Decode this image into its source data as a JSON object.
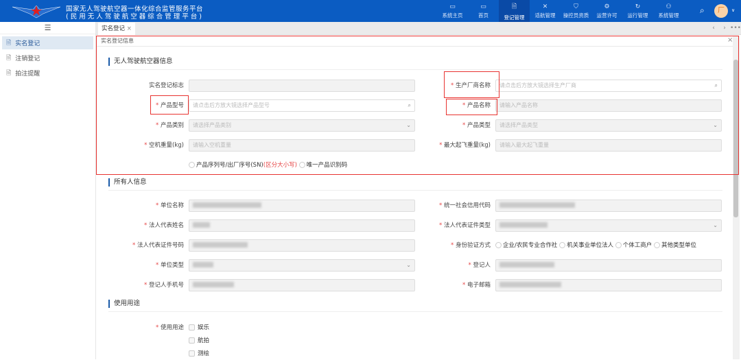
{
  "header": {
    "title_line1": "国家无人驾驶航空器一体化综合监管服务平台",
    "title_line2": "(民用无人驾驶航空器综合管理平台)",
    "brand_color": "#0b5cc2",
    "nav": [
      {
        "label": "系统主页",
        "icon": "window-icon"
      },
      {
        "label": "首页",
        "icon": "monitor-icon"
      },
      {
        "label": "登记管理",
        "icon": "document-icon",
        "active": true
      },
      {
        "label": "适航管理",
        "icon": "drone-icon"
      },
      {
        "label": "操控员资质",
        "icon": "shield-icon"
      },
      {
        "label": "运营许可",
        "icon": "gear-icon"
      },
      {
        "label": "运行管理",
        "icon": "refresh-icon"
      },
      {
        "label": "系统管理",
        "icon": "network-icon"
      }
    ],
    "avatar_letter": "厂"
  },
  "sidebar": {
    "items": [
      {
        "label": "实名登记",
        "active": true
      },
      {
        "label": "注销登记"
      },
      {
        "label": "拍注提醒"
      }
    ]
  },
  "tabs": [
    {
      "label": "实名登记",
      "close": "×"
    }
  ],
  "panel": {
    "title": "实名登记信息",
    "close": "×"
  },
  "uav": {
    "section": "无人驾驶航空器信息",
    "left": [
      {
        "label": "实名登记标志",
        "placeholder": "",
        "required": false
      },
      {
        "label": "产品型号",
        "placeholder": "请点击后方放大镜选择产品型号",
        "required": true
      },
      {
        "label": "产品类别",
        "placeholder": "请选择产品类别",
        "required": true
      },
      {
        "label": "空机重量(kg)",
        "placeholder": "请输入空机重量",
        "required": true
      }
    ],
    "right": [
      {
        "label": "生产厂商名称",
        "placeholder": "请点击后方放大镜选择生产厂商",
        "required": true
      },
      {
        "label": "产品名称",
        "placeholder": "请输入产品名称",
        "required": true
      },
      {
        "label": "产品类型",
        "placeholder": "请选择产品类型",
        "required": true
      },
      {
        "label": "最大起飞重量(kg)",
        "placeholder": "请输入最大起飞重量",
        "required": true
      }
    ],
    "id_options": {
      "sn": "产品序列号/出厂序号(SN)",
      "sn_note": "(区分大小写)",
      "uid": "唯一产品识别码"
    }
  },
  "owner": {
    "section": "所有人信息",
    "left": [
      "单位名称",
      "法人代表姓名",
      "法人代表证件号码",
      "单位类型",
      "登记人手机号"
    ],
    "right": [
      "统一社会信用代码",
      "法人代表证件类型",
      "身份验证方式",
      "登记人",
      "电子邮箱"
    ],
    "verify_options": [
      "企业/农民专业合作社",
      "机关事业单位法人",
      "个体工商户",
      "其他类型单位"
    ]
  },
  "usage": {
    "section": "使用用途",
    "label": "使用用途",
    "options": [
      "娱乐",
      "航拍",
      "测绘"
    ]
  }
}
